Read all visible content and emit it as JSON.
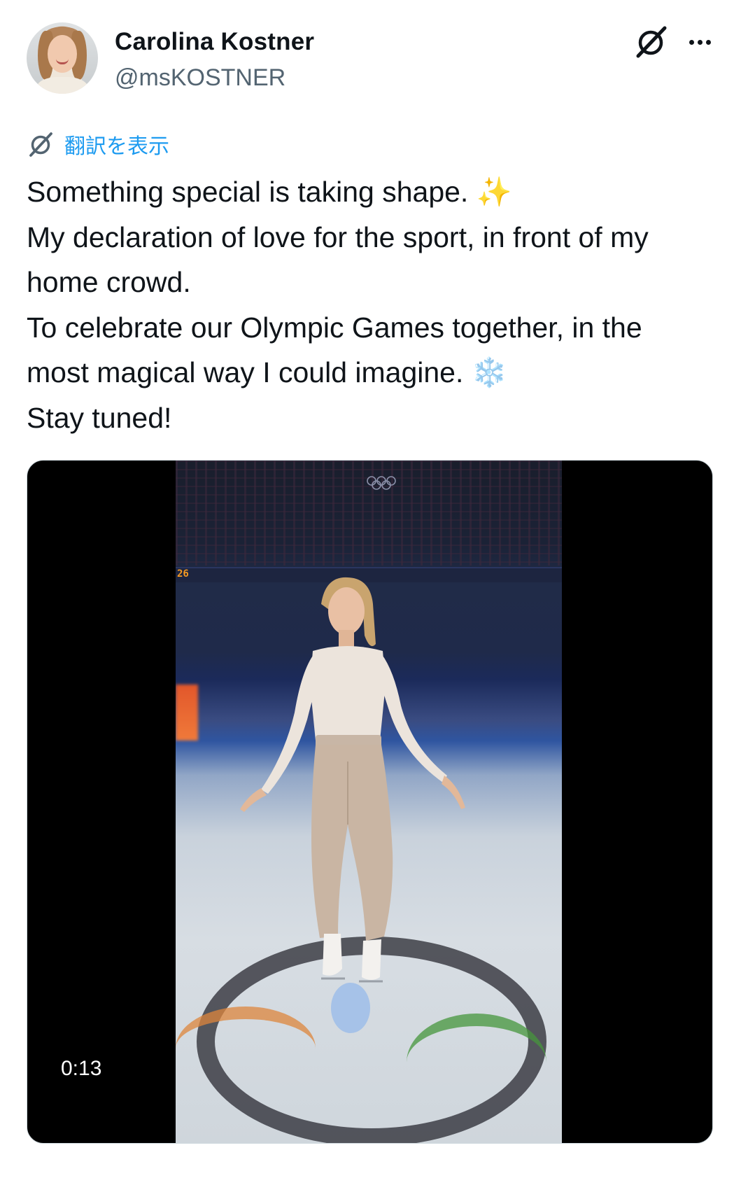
{
  "author": {
    "display_name": "Carolina Kostner",
    "handle": "@msKOSTNER"
  },
  "header_actions": {
    "grok_icon": "grok-icon",
    "more_icon": "more-horizontal-icon"
  },
  "translate": {
    "label": "翻訳を表示",
    "icon": "grok-icon"
  },
  "tweet": {
    "lines": [
      "Something special is taking shape. ✨",
      "My declaration of love for the sport, in front of my",
      "home crowd.",
      "To celebrate our Olympic Games together, in the",
      "most magical way I could imagine. ❄️",
      "Stay tuned!"
    ]
  },
  "media": {
    "type": "video",
    "duration": "0:13",
    "scoreboard": "26"
  },
  "colors": {
    "link": "#1d9bf0",
    "text": "#0f1419",
    "secondary": "#536471"
  }
}
